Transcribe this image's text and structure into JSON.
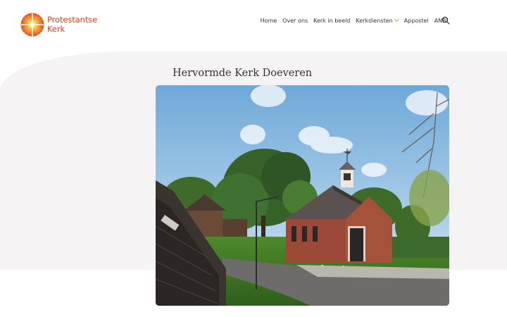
{
  "brand": {
    "line1": "Protestantse",
    "line2": "Kerk",
    "color": "#e2401c"
  },
  "nav": {
    "items": [
      {
        "label": "Home"
      },
      {
        "label": "Over ons"
      },
      {
        "label": "Kerk in beeld"
      },
      {
        "label": "Kerkdiensten",
        "has_dropdown": true
      },
      {
        "label": "Appostel"
      },
      {
        "label": "ANBI"
      }
    ],
    "search_icon": "search-icon",
    "accent": "#e8a13a"
  },
  "main": {
    "title": "Hervormde Kerk Doeveren",
    "image_icon": "church-photo"
  }
}
